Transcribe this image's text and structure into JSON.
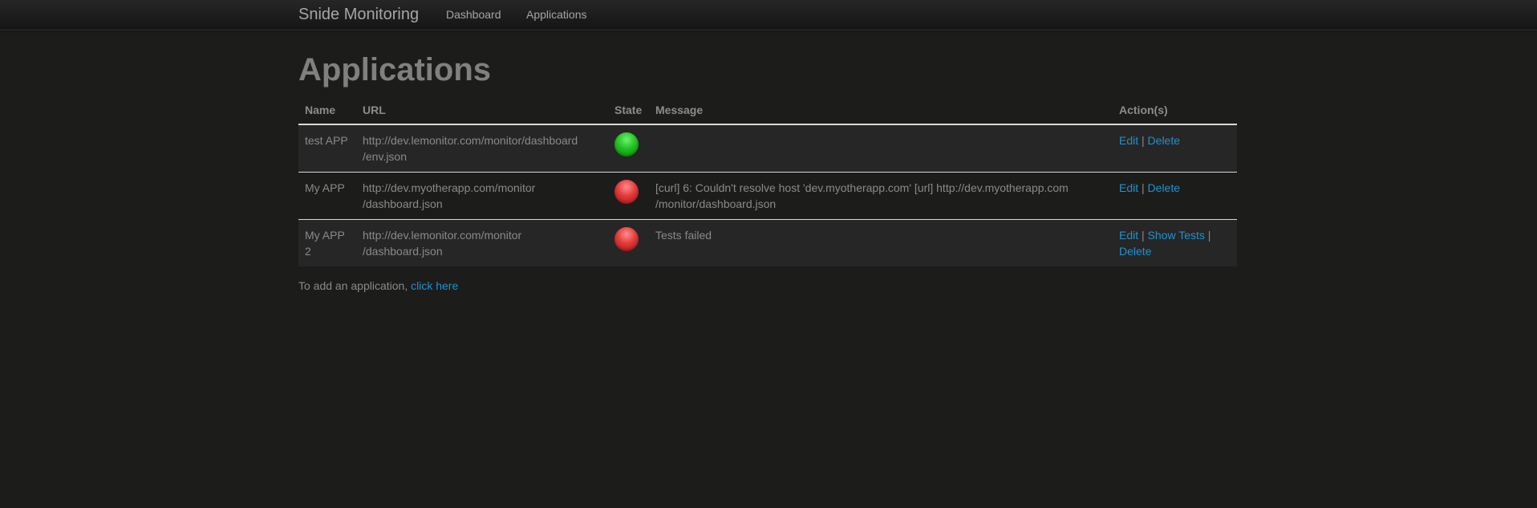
{
  "navbar": {
    "brand": "Snide Monitoring",
    "links": [
      {
        "label": "Dashboard"
      },
      {
        "label": "Applications"
      }
    ]
  },
  "page": {
    "title": "Applications"
  },
  "table": {
    "headers": [
      "Name",
      "URL",
      "State",
      "Message",
      "Action(s)"
    ],
    "rows": [
      {
        "name": "test APP",
        "url_line1": "http://dev.lemonitor.com/monitor/dashboard",
        "url_line2": "/env.json",
        "state": "ok",
        "message_line1": "",
        "message_line2": "",
        "actions": {
          "edit": "Edit",
          "delete": "Delete"
        }
      },
      {
        "name": "My APP",
        "url_line1": "http://dev.myotherapp.com/monitor",
        "url_line2": "/dashboard.json",
        "state": "fail",
        "message_line1": "[curl] 6: Couldn't resolve host 'dev.myotherapp.com' [url] http://dev.myotherapp.com",
        "message_line2": "/monitor/dashboard.json",
        "actions": {
          "edit": "Edit",
          "delete": "Delete"
        }
      },
      {
        "name_line1": "My APP",
        "name_line2": "2",
        "url_line1": "http://dev.lemonitor.com/monitor",
        "url_line2": "/dashboard.json",
        "state": "fail",
        "message_line1": "Tests failed",
        "actions": {
          "edit": "Edit",
          "show_tests": "Show Tests",
          "delete": "Delete"
        }
      }
    ],
    "separator": "|"
  },
  "footer": {
    "text": "To add an application, ",
    "link": "click here"
  },
  "colors": {
    "background": "#1c1c1a",
    "link": "#1d93d2",
    "state_ok": "#22c122",
    "state_fail": "#e23a3a"
  }
}
